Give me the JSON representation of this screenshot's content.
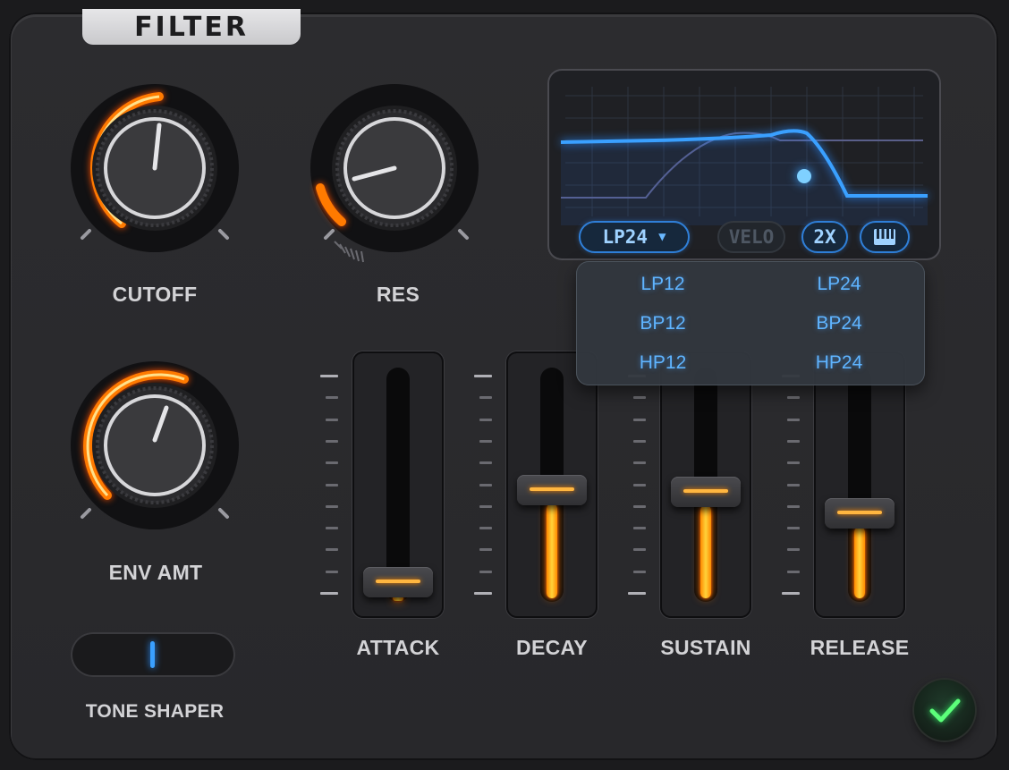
{
  "panel": {
    "title": "FILTER"
  },
  "knobs": {
    "cutoff": {
      "label": "CUTOFF",
      "value": 0.55
    },
    "res": {
      "label": "RES",
      "value": 0.12
    },
    "env_amt": {
      "label": "ENV AMT",
      "value": 0.58
    }
  },
  "display": {
    "mode_label": "LP24",
    "velo_label": "VELO",
    "oversample_label": "2X",
    "keyboard_icon": "piano-keys-icon"
  },
  "dropdown": {
    "items": [
      "LP12",
      "LP24",
      "BP12",
      "BP24",
      "HP12",
      "HP24"
    ]
  },
  "envelope": {
    "attack": {
      "label": "ATTACK",
      "value": 0.02
    },
    "decay": {
      "label": "DECAY",
      "value": 0.45
    },
    "sustain": {
      "label": "SUSTAIN",
      "value": 0.44
    },
    "release": {
      "label": "RELEASE",
      "value": 0.34
    }
  },
  "tone_shaper": {
    "label": "TONE SHAPER",
    "value": 0.5
  },
  "confirm": {
    "icon": "checkmark-icon"
  },
  "colors": {
    "accent": "#ff8a00",
    "display_blue": "#3aa0ff",
    "ok_green": "#5cff7a"
  }
}
